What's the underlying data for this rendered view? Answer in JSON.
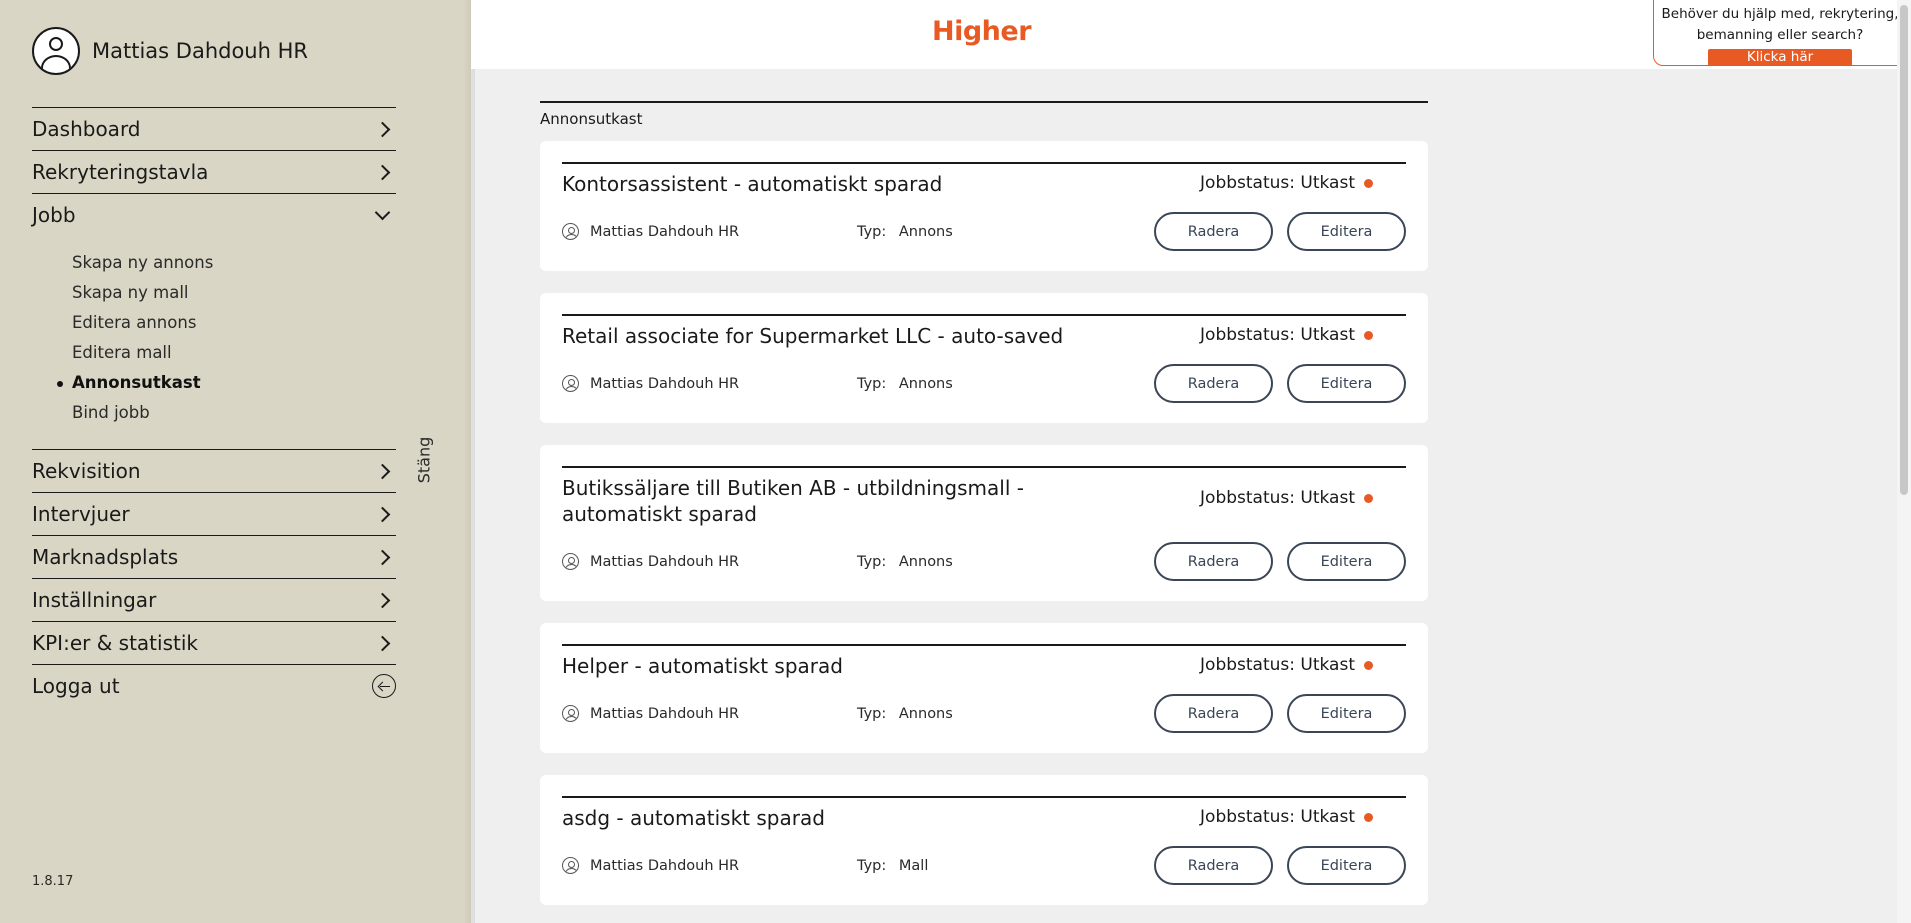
{
  "sidebar": {
    "user_name": "Mattias Dahdouh HR",
    "nav": [
      {
        "label": "Dashboard"
      },
      {
        "label": "Rekryteringstavla"
      },
      {
        "label": "Jobb"
      }
    ],
    "jobb_sub": [
      {
        "label": "Skapa ny annons",
        "active": false
      },
      {
        "label": "Skapa ny mall",
        "active": false
      },
      {
        "label": "Editera annons",
        "active": false
      },
      {
        "label": "Editera mall",
        "active": false
      },
      {
        "label": "Annonsutkast",
        "active": true
      },
      {
        "label": "Bind jobb",
        "active": false
      }
    ],
    "nav2": [
      {
        "label": "Rekvisition"
      },
      {
        "label": "Intervjuer"
      },
      {
        "label": "Marknadsplats"
      },
      {
        "label": "Inställningar"
      },
      {
        "label": "KPI:er & statistik"
      }
    ],
    "logout_label": "Logga ut",
    "close_label": "Stäng",
    "version": "1.8.17"
  },
  "header": {
    "logo": "Higher",
    "help_text_line1": "Behöver du hjälp med, rekrytering,",
    "help_text_line2": "bemanning eller search?",
    "help_button": "Klicka här"
  },
  "main": {
    "section_title": "Annonsutkast",
    "status_label": "Jobbstatus: Utkast",
    "type_label": "Typ:",
    "delete_label": "Radera",
    "edit_label": "Editera",
    "drafts": [
      {
        "title": "Kontorsassistent - automatiskt sparad",
        "owner": "Mattias Dahdouh HR",
        "type": "Annons"
      },
      {
        "title": "Retail associate for Supermarket LLC - auto-saved",
        "owner": "Mattias Dahdouh HR",
        "type": "Annons"
      },
      {
        "title": "Butikssäljare till Butiken AB - utbildningsmall - automatiskt sparad",
        "owner": "Mattias Dahdouh HR",
        "type": "Annons"
      },
      {
        "title": "Helper - automatiskt sparad",
        "owner": "Mattias Dahdouh HR",
        "type": "Annons"
      },
      {
        "title": "asdg - automatiskt sparad",
        "owner": "Mattias Dahdouh HR",
        "type": "Mall"
      }
    ]
  },
  "colors": {
    "accent": "#e85a24",
    "sidebar_bg": "#d9d6c5",
    "button_border": "#3a4556",
    "page_bg": "#efefef"
  }
}
